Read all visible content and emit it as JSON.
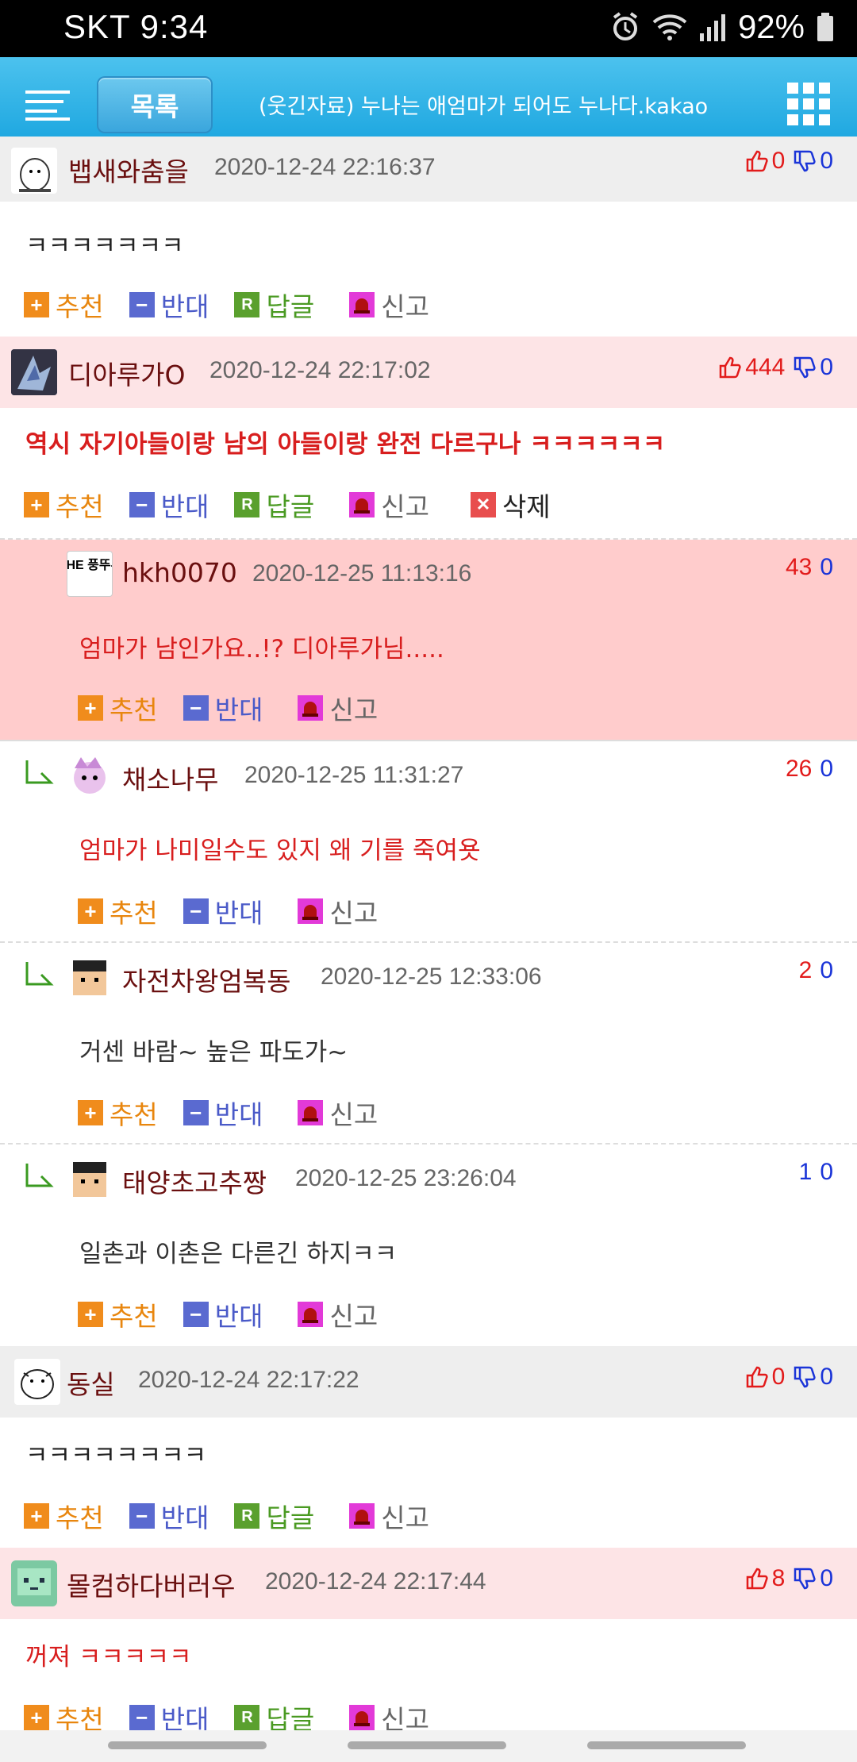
{
  "status": {
    "carrier": "SKT 9:34",
    "battery": "92%"
  },
  "header": {
    "list_label": "목록",
    "title": "(웃긴자료) 누나는 애엄마가 되어도 누나다.kakao"
  },
  "actions": {
    "recommend": "추천",
    "oppose": "반대",
    "reply": "답글",
    "report": "신고",
    "delete": "삭제",
    "reply_icon": "R"
  },
  "comments": [
    {
      "nick": "뱁새와춤을",
      "date": "2020-12-24 22:16:37",
      "up": "0",
      "down": "0",
      "text": "ㅋㅋㅋㅋㅋㅋㅋ"
    },
    {
      "nick": "디아루가O",
      "date": "2020-12-24 22:17:02",
      "up": "444",
      "down": "0",
      "text": "역시 자기아들이랑 남의 아들이랑 완전 다르구나 ㅋㅋㅋㅋㅋㅋ"
    },
    {
      "nick": "hkh0070",
      "date": "2020-12-25 11:13:16",
      "up": "43",
      "down": "0",
      "text": "엄마가 남인가요..!? 디아루가님....."
    },
    {
      "nick": "채소나무",
      "date": "2020-12-25 11:31:27",
      "up": "26",
      "down": "0",
      "text": "엄마가 나미일수도 있지 왜 기를 죽여욧"
    },
    {
      "nick": "자전차왕엄복동",
      "date": "2020-12-25 12:33:06",
      "up": "2",
      "down": "0",
      "text": "거센 바람~ 높은 파도가~"
    },
    {
      "nick": "태양초고추짱",
      "date": "2020-12-25 23:26:04",
      "up": "1",
      "down": "0",
      "text": "일촌과 이촌은 다른긴 하지ㅋㅋ"
    },
    {
      "nick": "동실",
      "date": "2020-12-24 22:17:22",
      "up": "0",
      "down": "0",
      "text": "ㅋㅋㅋㅋㅋㅋㅋㅋ"
    },
    {
      "nick": "몰컴하다버러우",
      "date": "2020-12-24 22:17:44",
      "up": "8",
      "down": "0",
      "text": "꺼져 ㅋㅋㅋㅋㅋ"
    }
  ],
  "avatar_text": "THE 풍뚜루"
}
